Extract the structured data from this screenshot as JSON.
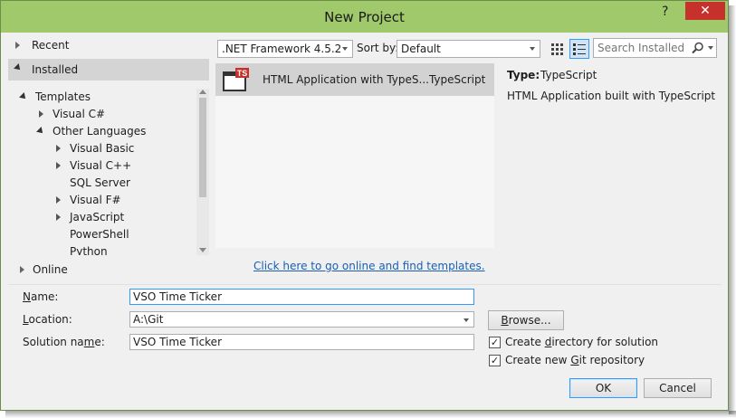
{
  "window": {
    "title": "New Project",
    "help_glyph": "?",
    "close_glyph": "✕"
  },
  "left_nav": {
    "recent": "Recent",
    "installed": "Installed",
    "online": "Online",
    "tree": [
      {
        "label": "Templates",
        "level": 0,
        "expander": "expanded"
      },
      {
        "label": "Visual C#",
        "level": 1,
        "expander": "collapsed"
      },
      {
        "label": "Other Languages",
        "level": 1,
        "expander": "expanded"
      },
      {
        "label": "Visual Basic",
        "level": 2,
        "expander": "collapsed"
      },
      {
        "label": "Visual C++",
        "level": 2,
        "expander": "collapsed"
      },
      {
        "label": "SQL Server",
        "level": 2,
        "expander": "none"
      },
      {
        "label": "Visual F#",
        "level": 2,
        "expander": "collapsed"
      },
      {
        "label": "JavaScript",
        "level": 2,
        "expander": "collapsed"
      },
      {
        "label": "PowerShell",
        "level": 2,
        "expander": "none"
      },
      {
        "label": "Python",
        "level": 2,
        "expander": "none"
      }
    ]
  },
  "toolbar": {
    "framework": ".NET Framework 4.5.2",
    "sort_by_label": "Sort by:",
    "sort_by_value": "Default",
    "search_placeholder": "Search Installed Te"
  },
  "templates": {
    "items": [
      {
        "name": "HTML Application with TypeS...TypeScript",
        "icon_badge": "TS"
      }
    ],
    "online_link": "Click here to go online and find templates."
  },
  "details": {
    "type_label": "Type:",
    "type_value": "TypeScript",
    "description": "HTML Application built with TypeScript"
  },
  "form": {
    "name_label_pre": "",
    "name_label_mn": "N",
    "name_label_post": "ame:",
    "name_value": "VSO Time Ticker",
    "location_label_pre": "",
    "location_label_mn": "L",
    "location_label_post": "ocation:",
    "location_value": "A:\\Git",
    "solution_label_pre": "Solution na",
    "solution_label_mn": "m",
    "solution_label_post": "e:",
    "solution_value": "VSO Time Ticker",
    "browse_pre": "",
    "browse_mn": "B",
    "browse_post": "rowse...",
    "create_dir_pre": "Create ",
    "create_dir_mn": "d",
    "create_dir_post": "irectory for solution",
    "create_dir_checked": true,
    "create_git_pre": "Create new ",
    "create_git_mn": "G",
    "create_git_post": "it repository",
    "create_git_checked": true,
    "ok": "OK",
    "cancel": "Cancel",
    "check_glyph": "✓"
  }
}
